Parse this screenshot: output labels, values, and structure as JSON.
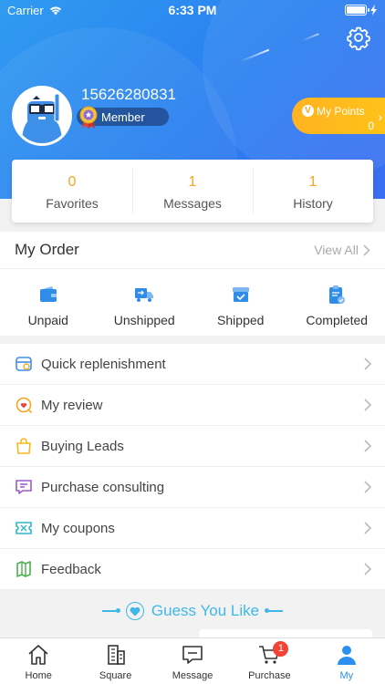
{
  "status_bar": {
    "carrier": "Carrier",
    "time": "6:33 PM"
  },
  "profile": {
    "phone": "15626280831",
    "level": "Member"
  },
  "points": {
    "label": "My Points",
    "value": "0"
  },
  "stats": [
    {
      "value": "0",
      "label": "Favorites"
    },
    {
      "value": "1",
      "label": "Messages"
    },
    {
      "value": "1",
      "label": "History"
    }
  ],
  "order": {
    "title": "My Order",
    "view_all": "View All",
    "items": [
      {
        "label": "Unpaid",
        "icon": "wallet-icon"
      },
      {
        "label": "Unshipped",
        "icon": "truck-icon"
      },
      {
        "label": "Shipped",
        "icon": "box-icon"
      },
      {
        "label": "Completed",
        "icon": "clipboard-check-icon"
      }
    ]
  },
  "menu": [
    {
      "label": "Quick replenishment",
      "icon": "replenish-icon",
      "color": "#3d8ef0"
    },
    {
      "label": "My review",
      "icon": "review-icon",
      "color": "#f5a623"
    },
    {
      "label": "Buying Leads",
      "icon": "bag-icon",
      "color": "#f5b820"
    },
    {
      "label": "Purchase consulting",
      "icon": "consult-icon",
      "color": "#9b59d0"
    },
    {
      "label": "My coupons",
      "icon": "coupon-icon",
      "color": "#2fb7c8"
    },
    {
      "label": "Feedback",
      "icon": "feedback-icon",
      "color": "#4caf50"
    }
  ],
  "guess": {
    "title": "Guess You Like"
  },
  "tabs": [
    {
      "label": "Home",
      "icon": "home-icon"
    },
    {
      "label": "Square",
      "icon": "building-icon"
    },
    {
      "label": "Message",
      "icon": "message-icon"
    },
    {
      "label": "Purchase",
      "icon": "cart-icon",
      "badge": "1"
    },
    {
      "label": "My",
      "icon": "person-icon",
      "active": true
    }
  ],
  "colors": {
    "accent": "#2b8ff0",
    "points": "#ffb320",
    "count": "#f5a623",
    "badge": "#f44336"
  }
}
